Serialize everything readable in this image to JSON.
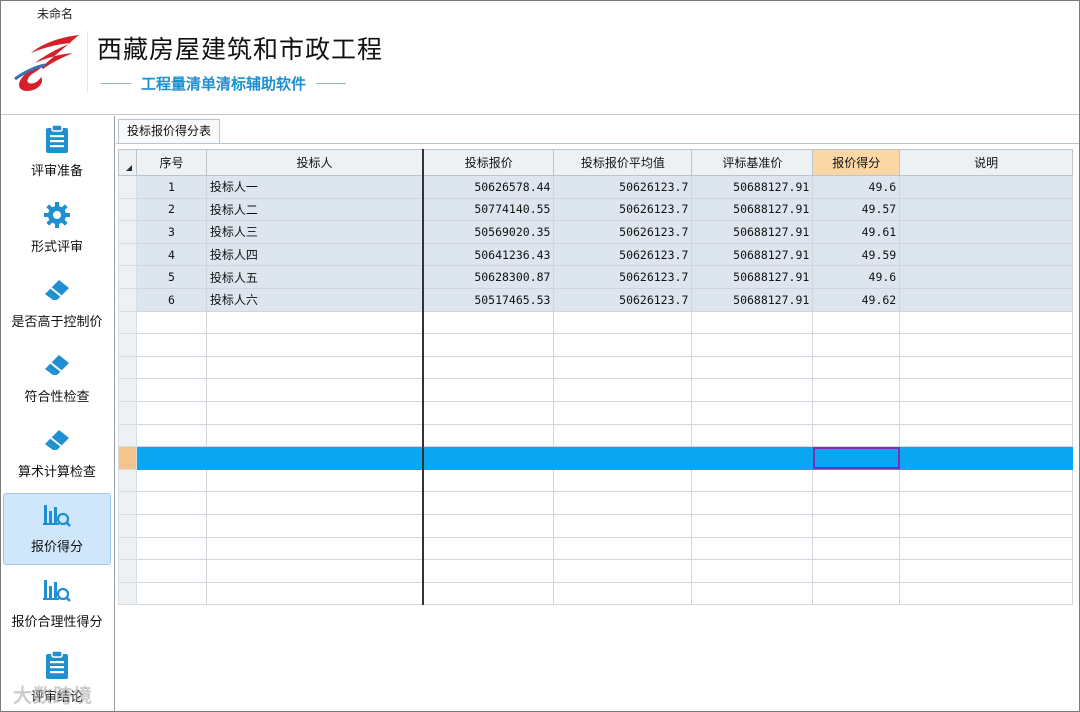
{
  "window": {
    "title": "未命名"
  },
  "header": {
    "title": "西藏房屋建筑和市政工程",
    "subtitle": "工程量清单清标辅助软件"
  },
  "sidebar": {
    "items": [
      {
        "label": "评审准备",
        "icon": "clipboard-icon",
        "active": false
      },
      {
        "label": "形式评审",
        "icon": "gear-icon",
        "active": false
      },
      {
        "label": "是否高于控制价",
        "icon": "eraser-icon",
        "active": false
      },
      {
        "label": "符合性检查",
        "icon": "eraser-icon",
        "active": false
      },
      {
        "label": "算术计算检查",
        "icon": "eraser-icon",
        "active": false
      },
      {
        "label": "报价得分",
        "icon": "bar-chart-search-icon",
        "active": true
      },
      {
        "label": "报价合理性得分",
        "icon": "bar-chart-search-icon",
        "active": false
      },
      {
        "label": "评审结论",
        "icon": "clipboard-icon",
        "active": false
      }
    ]
  },
  "tab": {
    "label": "投标报价得分表"
  },
  "table": {
    "headers": [
      "序号",
      "投标人",
      "投标报价",
      "投标报价平均值",
      "评标基准价",
      "报价得分",
      "说明"
    ],
    "rows": [
      [
        "1",
        "投标人一",
        "50626578.44",
        "50626123.7",
        "50688127.91",
        "49.6",
        ""
      ],
      [
        "2",
        "投标人二",
        "50774140.55",
        "50626123.7",
        "50688127.91",
        "49.57",
        ""
      ],
      [
        "3",
        "投标人三",
        "50569020.35",
        "50626123.7",
        "50688127.91",
        "49.61",
        ""
      ],
      [
        "4",
        "投标人四",
        "50641236.43",
        "50626123.7",
        "50688127.91",
        "49.59",
        ""
      ],
      [
        "5",
        "投标人五",
        "50628300.87",
        "50626123.7",
        "50688127.91",
        "49.6",
        ""
      ],
      [
        "6",
        "投标人六",
        "50517465.53",
        "50626123.7",
        "50688127.91",
        "49.62",
        ""
      ]
    ],
    "empty_rows_before_selection": 6,
    "empty_rows_after_selection": 6
  },
  "watermark": "大数跨境",
  "colors": {
    "selected_row": "#0aa6f2",
    "selected_header": "#fbd7a6",
    "data_row": "#dde6ef",
    "active_nav": "#cfe6fb",
    "subtitle": "#1e8fd0",
    "logo_red": "#d42028"
  }
}
